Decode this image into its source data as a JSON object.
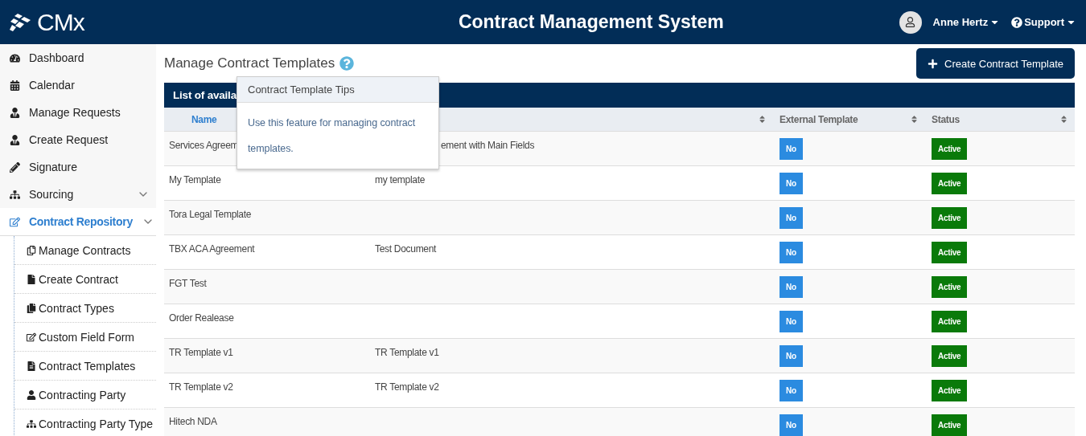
{
  "header": {
    "logo": "CMx",
    "title": "Contract Management System",
    "user": "Anne Hertz",
    "support": "Support"
  },
  "sidebar": {
    "items": [
      {
        "label": "Dashboard",
        "selected": false
      },
      {
        "label": "Calendar",
        "selected": false
      },
      {
        "label": "Manage Requests",
        "selected": false
      },
      {
        "label": "Create Request",
        "selected": false
      },
      {
        "label": "Signature",
        "selected": false
      },
      {
        "label": "Sourcing",
        "selected": false,
        "kind": "group"
      },
      {
        "label": "Contract Repository",
        "selected": true,
        "kind": "group",
        "expanded": true,
        "children": [
          {
            "label": "Manage Contracts"
          },
          {
            "label": "Create Contract"
          },
          {
            "label": "Contract Types"
          },
          {
            "label": "Custom Field Form"
          },
          {
            "label": "Contract Templates"
          },
          {
            "label": "Contracting Party"
          },
          {
            "label": "Contracting Party Type"
          }
        ]
      }
    ]
  },
  "page": {
    "title": "Manage Contract Templates",
    "create_button": "Create Contract Template"
  },
  "tip": {
    "title": "Contract Template Tips",
    "body": "Use this feature for managing contract templates."
  },
  "table": {
    "title": "List of availa",
    "columns": [
      {
        "label": "Name"
      },
      {},
      {
        "label": "External Template"
      },
      {
        "label": "Status"
      }
    ],
    "rows": [
      {
        "name": "Services Agreem",
        "description": "ement with Main Fields",
        "under_tip": true,
        "external": "No",
        "status": "Active"
      },
      {
        "name": "My Template",
        "description": "my template",
        "external": "No",
        "status": "Active"
      },
      {
        "name": "Tora Legal Template",
        "external": "No",
        "status": "Active"
      },
      {
        "name": "TBX ACA Agreement",
        "description": "Test Document",
        "external": "No",
        "status": "Active"
      },
      {
        "name": "FGT Test",
        "external": "No",
        "status": "Active"
      },
      {
        "name": "Order Realease",
        "external": "No",
        "status": "Active"
      },
      {
        "name": "TR Template v1",
        "description": "TR Template v1",
        "external": "No",
        "status": "Active"
      },
      {
        "name": "TR Template v2",
        "description": "TR Template v2",
        "external": "No",
        "status": "Active"
      },
      {
        "name": "Hitech NDA",
        "external": "No",
        "status": "Active"
      }
    ]
  }
}
